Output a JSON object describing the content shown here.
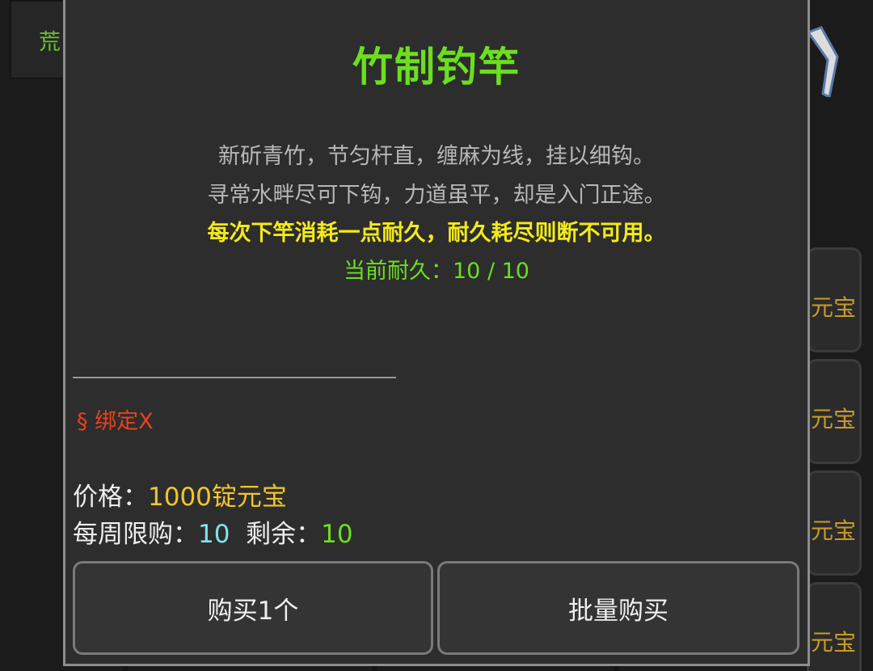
{
  "background": {
    "tab_label": "荒",
    "shop_cards": [
      {
        "price_text": "元宝"
      },
      {
        "price_text": "元宝"
      },
      {
        "price_text": "元宝"
      },
      {
        "price_text": "元宝"
      }
    ],
    "close_icon": "close-x-icon"
  },
  "modal": {
    "title": "竹制钓竿",
    "description": [
      "新斫青竹，节匀杆直，缠麻为线，挂以细钩。",
      "寻常水畔尽可下钩，力道虽平，却是入门正途。"
    ],
    "rule_text": "每次下竿消耗一点耐久，耐久耗尽则断不可用。",
    "durability_text": "当前耐久：10 / 10",
    "bind_tag": "§ 绑定X",
    "price": {
      "label": "价格：",
      "value": "1000锭元宝"
    },
    "weekly_limit": {
      "label": "每周限购：",
      "value": "10",
      "remaining_label": "剩余：",
      "remaining_value": "10"
    },
    "buttons": {
      "buy_one": "购买1个",
      "bulk_buy": "批量购买"
    }
  },
  "colors": {
    "title": "#6bdf1f",
    "description": "#b7b7b7",
    "rule": "#f2ea1b",
    "bind_tag": "#e8431d",
    "price": "#f1c62c",
    "limit": "#7fe5ec"
  }
}
